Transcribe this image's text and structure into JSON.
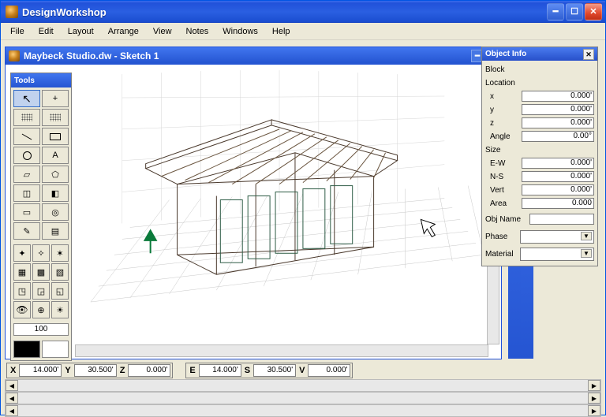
{
  "app": {
    "title": "DesignWorkshop"
  },
  "menu": {
    "items": [
      "File",
      "Edit",
      "Layout",
      "Arrange",
      "View",
      "Notes",
      "Windows",
      "Help"
    ]
  },
  "doc": {
    "title": "Maybeck Studio.dw - Sketch 1"
  },
  "tools": {
    "title": "Tools",
    "zoom": "100"
  },
  "coords": {
    "X": "14.000'",
    "Y": "30.500'",
    "Z": "0.000'",
    "E": "14.000'",
    "S": "30.500'",
    "V": "0.000'"
  },
  "object_info": {
    "title": "Object Info",
    "type": "Block",
    "location_label": "Location",
    "x": "0.000'",
    "y": "0.000'",
    "z": "0.000'",
    "angle_label": "Angle",
    "angle": "0.00°",
    "size_label": "Size",
    "ew_label": "E-W",
    "ew": "0.000'",
    "ns_label": "N-S",
    "ns": "0.000'",
    "vert_label": "Vert",
    "vert": "0.000'",
    "area_label": "Area",
    "area": "0.000",
    "objname_label": "Obj Name",
    "objname": "",
    "phase_label": "Phase",
    "material_label": "Material"
  }
}
